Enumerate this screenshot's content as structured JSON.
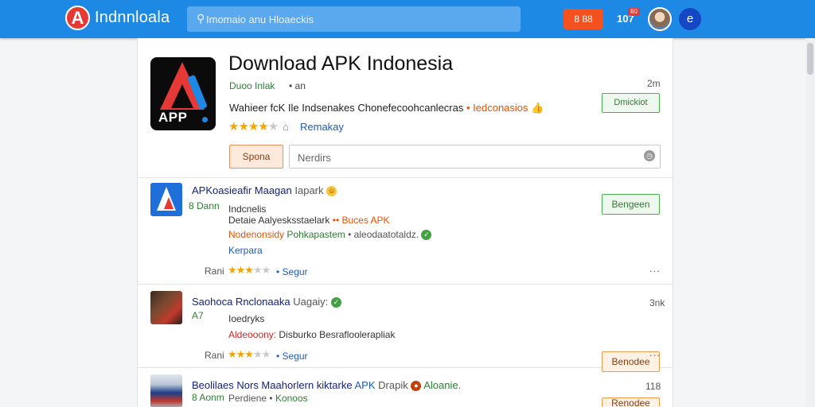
{
  "topbar": {
    "logo_letter": "A",
    "brand": "Indnnloala",
    "search_placeholder": "Imomaio anu Hloaeckis",
    "notif_label": "8 88",
    "count": "107",
    "count_badge": "80",
    "user_initial": "e"
  },
  "header": {
    "app_icon_text": "APP",
    "title": "Download APK Indonesia",
    "developer": "Duoo Inlak",
    "meta": "• an",
    "size": "2m",
    "description": "Wahieer fcK Ile Indsenakes Chonefecoohcanlecras",
    "description_tag": "• Iedconasios",
    "stars": "★★★★",
    "stars_off": "★",
    "home_icon": "⌂",
    "review_link": "Remakay",
    "download_label": "Dmickiot",
    "filter_button": "Spona",
    "field_placeholder": "Nerdirs"
  },
  "items": [
    {
      "title": "APKoasieafir Maagan",
      "title_tag": "Iapark",
      "size": "",
      "sub": "8 Dann",
      "line2": "Indcnelis",
      "line3_a": "Detaie Aalyesksstaelark",
      "line3_b": "•• Buces APK",
      "line4_a": "Nodenonsidy",
      "line4_b": "Pohkapastem",
      "line4_c": "• aleodaatotaldz.",
      "line5": "Kerpara",
      "rating_label": "Rani",
      "stars": "★★★",
      "stars_off": "★★",
      "link": "• Segur",
      "button": "Bengeen",
      "more": "..."
    },
    {
      "title": "Saohoca Rnclonaaka",
      "title_tag": "Uagaiy:",
      "size": "3nk",
      "sub": "A7",
      "line2": "Ioedryks",
      "line3_a": "Aldeooony:",
      "line3_b": "Disburko Besrafloolerapliak",
      "rating_label": "Rani",
      "stars": "★★★",
      "stars_off": "★★",
      "link": "• Segur",
      "button": "Benodee",
      "more": "..."
    },
    {
      "title": "Beolilaes Nors Maahorlern kiktarke",
      "title_apk": "APK",
      "title_tag": "Drapik",
      "title_tag2": "Aloanie.",
      "size": "118",
      "sub": "8 Aonm",
      "line2_a": "Perdiene",
      "line2_b": "•",
      "line2_c": "Konoos",
      "button": "Renodee"
    }
  ],
  "colors": {
    "topbar": "#1e88e5",
    "accent_green": "#2e7d32",
    "accent_orange": "#e65100",
    "link_blue": "#1e5bb8"
  }
}
